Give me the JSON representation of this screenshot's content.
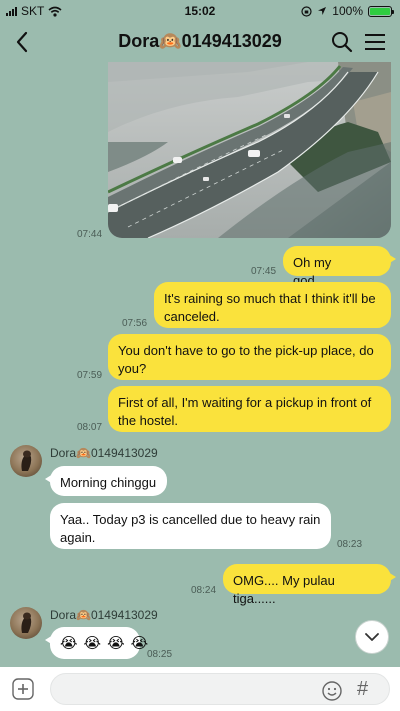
{
  "status_bar": {
    "carrier": "SKT",
    "time": "15:02",
    "battery": "100%",
    "battery_level": 1.0
  },
  "header": {
    "title": "Dora🙉0149413029",
    "back_icon": "chevron-left-icon",
    "search_icon": "search-icon",
    "menu_icon": "hamburger-menu-icon"
  },
  "messages": {
    "photo_time": "07:44",
    "m1": {
      "text": "Oh my god.......",
      "time": "07:45"
    },
    "m2": {
      "text": "It's raining so much that I think it'll be canceled.",
      "time": "07:56"
    },
    "m3": {
      "text": "You don't have to go to the pick-up place, do you?",
      "time": "07:59"
    },
    "m4": {
      "text": "First of all, I'm waiting for a pickup in front of the hostel.",
      "time": "08:07"
    },
    "sender1": "Dora🙉0149413029",
    "m5": {
      "text": "Morning chinggu"
    },
    "m6": {
      "text": "Yaa.. Today p3 is cancelled due to heavy rain again.",
      "time": "08:23"
    },
    "m7": {
      "text": "OMG.... My pulau tiga......",
      "time": "08:24"
    },
    "sender2": "Dora🙉0149413029",
    "m8": {
      "emojis": [
        "😭",
        "😭",
        "😭",
        "😭"
      ],
      "time": "08:25"
    }
  },
  "input": {
    "plus_icon": "plus-icon",
    "emoji_icon": "emoji-icon",
    "hash_label": "#"
  },
  "colors": {
    "background": "#9bbbae",
    "my_bubble": "#fae23c",
    "other_bubble": "#ffffff"
  }
}
